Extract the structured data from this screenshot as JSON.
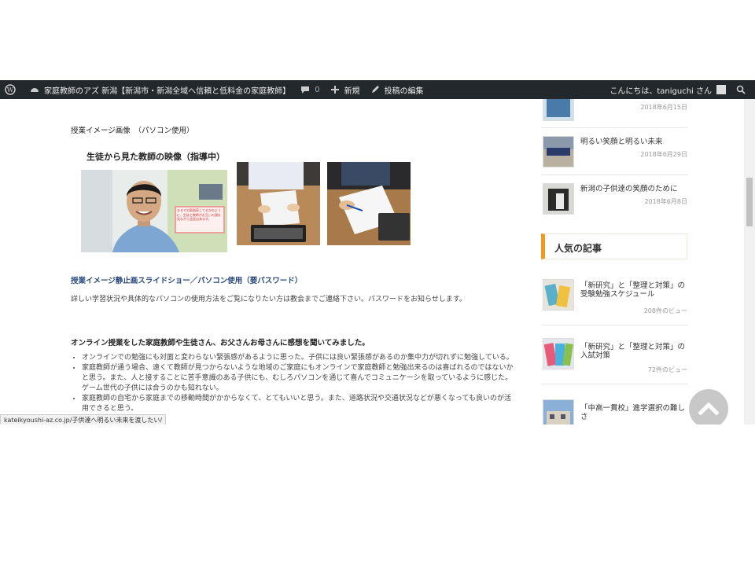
{
  "adminbar": {
    "site_name": "家庭教師のアズ 新潟【新潟市・新潟全域へ信頼と低料金の家庭教師】",
    "comments_count": "0",
    "new_label": "新規",
    "edit_label": "投稿の編集",
    "greeting": "こんにちは、taniguchi さん"
  },
  "main": {
    "heading_images": "授業イメージ画像　（パソコン使用）",
    "photo_caption": "生徒から見た教師の映像（指導中）",
    "photo_overlay_text": "まるで対面指導してるかのように、生徒と教師がお互いの顔を見ながら会話出来ます。",
    "slideshow_link": "授業イメージ静止画スライドショー／パソコン使用（要パスワード）",
    "contact_note": "詳しい学習状況や具体的なパソコンの使用方法をご覧になりたい方は教会までご連絡下さい。パスワードをお知らせします。",
    "impressions_heading": "オンライン授業をした家庭教師や生徒さん、お父さんお母さんに感想を聞いてみました。",
    "bullets": [
      "オンラインでの勉強にも対面と変わらない緊張感があるように思った。子供には良い緊張感があるのか集中力が切れずに勉強している。",
      "家庭教師が通う場合、遠くて教師が見つからないような地域のご家庭にもオンラインで家庭教師と勉強出来るのは喜ばれるのではないかと思う。また、人と接することに苦手意識のある子供にも、むしろパソコンを通じて喜んでコミュニケーシを取っているように感じた。ゲーム世代の子供には合うのかも知れない。",
      "家庭教師の自宅から家庭までの移動時間がかからなくて、とてもいいと思う。また、道路状況や交通状況などが悪くなっても良いのが活用できると思う。"
    ]
  },
  "sidebar": {
    "recent": [
      {
        "title": "",
        "date": "2018年6月15日"
      },
      {
        "title": "明るい笑顔と明るい未来",
        "date": "2018年6月29日"
      },
      {
        "title": "新潟の子供達の笑顔のために",
        "date": "2018年6月8日"
      }
    ],
    "popular_heading": "人気の記事",
    "popular": [
      {
        "title": "「新研究」と「整理と対策」の受験勉強スケジュール",
        "views": "208件のビュー"
      },
      {
        "title": "「新研究」と「整理と対策」の入試対策",
        "views": "72件のビュー"
      },
      {
        "title": "「中高一貫校」進学選択の難しさ",
        "views": ""
      }
    ]
  },
  "status_url": "kateikyoushi-az.co.jp/子供達へ明るい未来を渡したい/",
  "colors": {
    "adminbar": "#23282d",
    "accent": "#f39a1e",
    "link": "#2a4a7a"
  }
}
